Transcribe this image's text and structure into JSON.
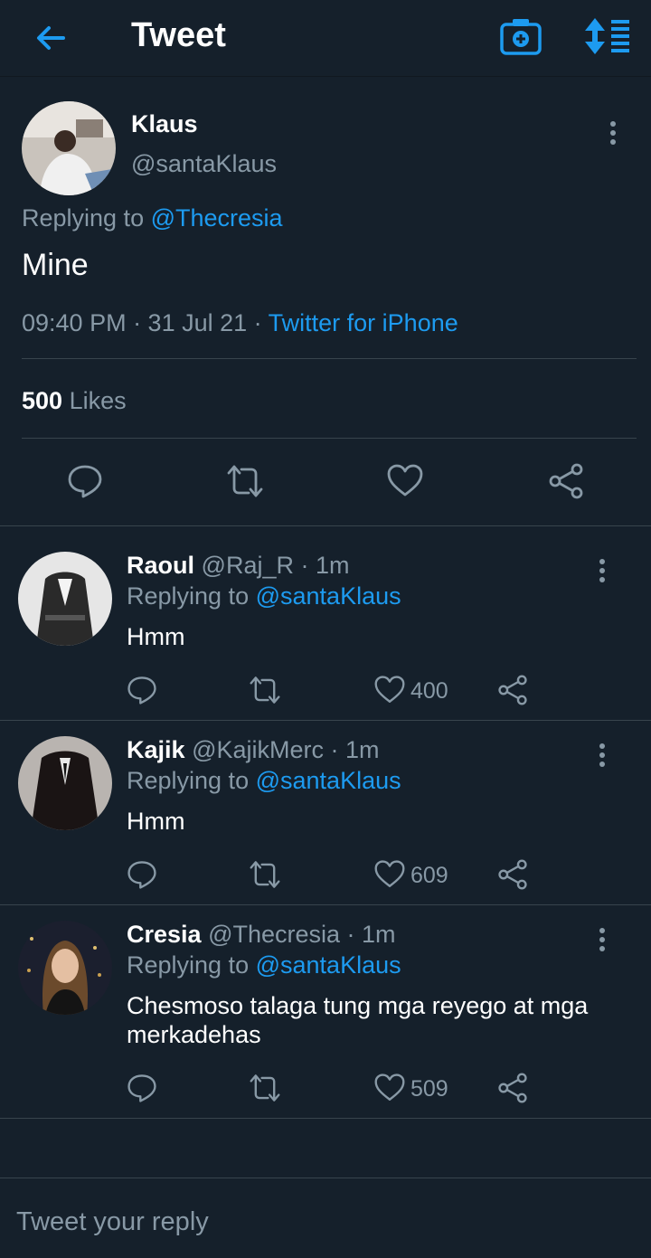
{
  "header": {
    "title": "Tweet"
  },
  "tweet": {
    "name": "Klaus",
    "handle": "@santaKlaus",
    "replying_prefix": "Replying to",
    "replying_to": "@Thecresia",
    "text": "Mine",
    "time": "09:40 PM · 31 Jul 21 · ",
    "source": "Twitter for iPhone",
    "likes_count": "500",
    "likes_label": "Likes"
  },
  "replies": [
    {
      "name": "Raoul",
      "handle": "@Raj_R · 1m",
      "replying_prefix": "Replying to",
      "replying_to": "@santaKlaus",
      "text": "Hmm",
      "likes": "400"
    },
    {
      "name": "Kajik",
      "handle": "@KajikMerc · 1m",
      "replying_prefix": "Replying to",
      "replying_to": "@santaKlaus",
      "text": "Hmm",
      "likes": "609"
    },
    {
      "name": "Cresia",
      "handle": "@Thecresia · 1m",
      "replying_prefix": "Replying to",
      "replying_to": "@santaKlaus",
      "text": "Chesmoso talaga tung mga reyego at mga merkadehas",
      "likes": "509"
    }
  ],
  "compose": {
    "placeholder": "Tweet your reply"
  },
  "colors": {
    "background": "#15202b",
    "accent": "#1d9bf0",
    "muted": "#8899a6",
    "divider": "#38444d"
  }
}
